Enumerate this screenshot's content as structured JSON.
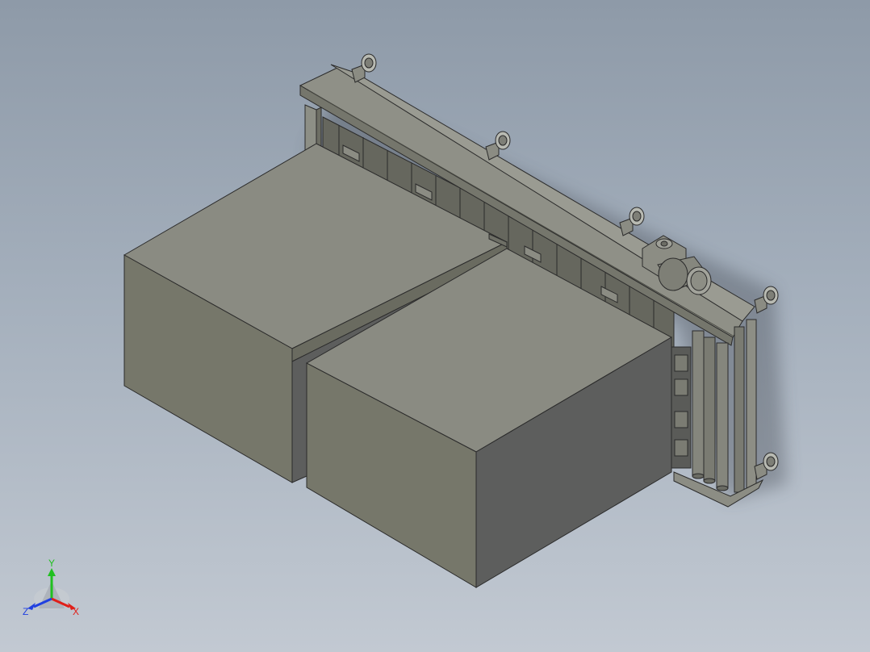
{
  "viewport": {
    "background_top": "#8e9aa8",
    "background_bottom": "#c2c9d2",
    "model_face_light": "#8a8b82",
    "model_face_mid": "#76776a",
    "model_face_dark": "#5d5e5d"
  },
  "triad": {
    "x_label": "X",
    "y_label": "Y",
    "z_label": "Z",
    "x_color": "#e0201a",
    "y_color": "#20c020",
    "z_color": "#2040e0"
  }
}
